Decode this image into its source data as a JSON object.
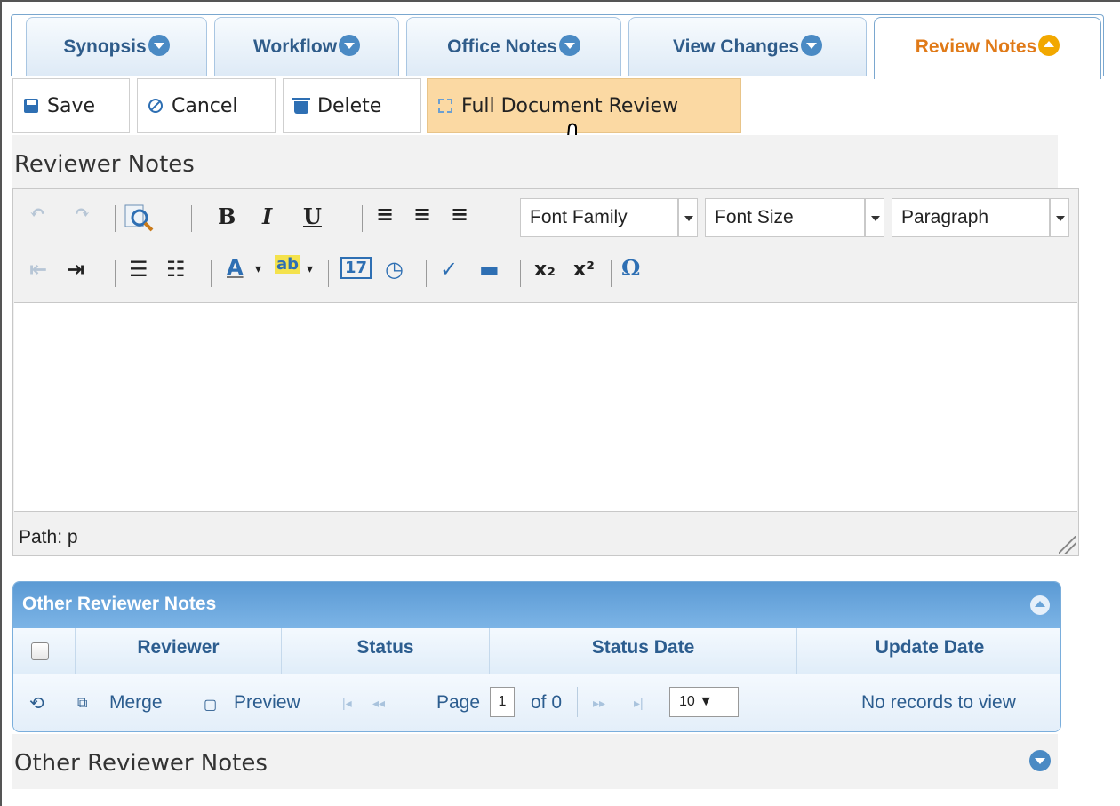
{
  "tabs": [
    {
      "label": "Synopsis",
      "active": false
    },
    {
      "label": "Workflow",
      "active": false
    },
    {
      "label": "Office Notes",
      "active": false
    },
    {
      "label": "View Changes",
      "active": false
    },
    {
      "label": "Review Notes",
      "active": true
    }
  ],
  "toolbar": {
    "save_label": "Save",
    "cancel_label": "Cancel",
    "delete_label": "Delete",
    "full_review_label": "Full Document Review"
  },
  "reviewer_notes": {
    "title": "Reviewer Notes",
    "editor": {
      "font_family": "Font Family",
      "font_size": "Font Size",
      "format": "Paragraph",
      "path_text": "Path: p",
      "content": ""
    }
  },
  "other_notes_grid": {
    "caption": "Other Reviewer Notes",
    "columns": [
      "Reviewer",
      "Status",
      "Status Date",
      "Update Date"
    ],
    "rows": [],
    "pager": {
      "merge_label": "Merge",
      "preview_label": "Preview",
      "page_label": "Page",
      "page_value": "1",
      "of_label": "of 0",
      "page_size": "10 ▼",
      "records_text": "No records to view"
    }
  },
  "other_notes_section": {
    "title": "Other Reviewer Notes"
  },
  "colors": {
    "tab_text": "#2f5c8a",
    "active_tab_text": "#e07a18",
    "hover_button": "#fbd9a3",
    "grid_caption": "#5b9ad4",
    "icon_blue": "#4a8ac4"
  }
}
